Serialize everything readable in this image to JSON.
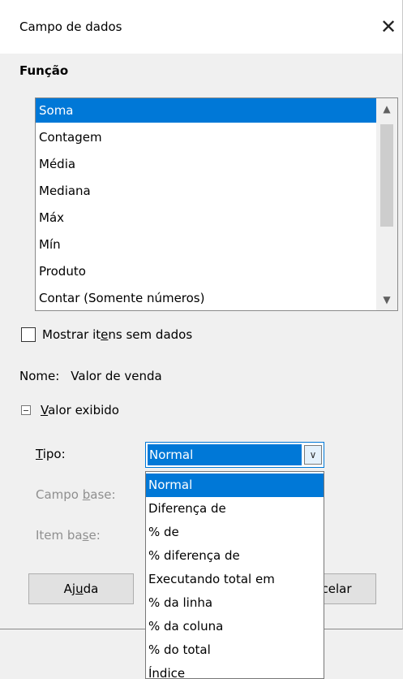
{
  "dialog": {
    "title": "Campo de dados",
    "close_icon": "close-icon"
  },
  "function_section": {
    "label": "Função",
    "items": [
      "Soma",
      "Contagem",
      "Média",
      "Mediana",
      "Máx",
      "Mín",
      "Produto",
      "Contar (Somente números)"
    ],
    "selected": "Soma"
  },
  "show_items": {
    "label_pre": "Mostrar it",
    "label_accel": "e",
    "label_post": "ns sem dados",
    "checked": false
  },
  "name_row": {
    "label": "Nome:",
    "value": "Valor de venda"
  },
  "displayed_value": {
    "accel": "V",
    "label_rest": "alor exibido",
    "expanded": true
  },
  "type_field": {
    "accel": "T",
    "label_rest": "ipo:",
    "value": "Normal"
  },
  "base_field": {
    "label_pre": "Campo ",
    "accel": "b",
    "label_post": "ase:"
  },
  "base_item": {
    "label_pre": "Item ba",
    "accel": "s",
    "label_post": "e:"
  },
  "buttons": {
    "help_pre": "Aj",
    "help_accel": "u",
    "help_post": "da",
    "cancel_visible": "ncelar"
  },
  "type_dropdown": {
    "options": [
      "Normal",
      "Diferença de",
      "% de",
      "% diferença de",
      "Executando total em",
      "% da linha",
      "% da coluna",
      "% do total",
      "Índice"
    ],
    "selected": "Normal"
  },
  "colors": {
    "selection": "#0078d7",
    "dialog_bg": "#f0f0f0"
  }
}
